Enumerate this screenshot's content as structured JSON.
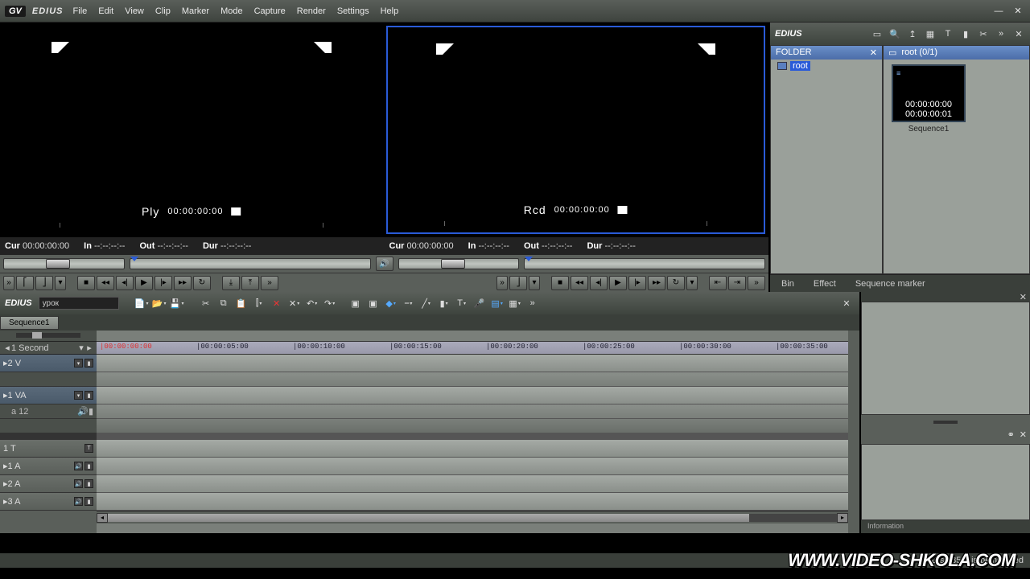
{
  "app": {
    "logo": "GV",
    "title": "EDIUS"
  },
  "menu": [
    "File",
    "Edit",
    "View",
    "Clip",
    "Marker",
    "Mode",
    "Capture",
    "Render",
    "Settings",
    "Help"
  ],
  "monitor_source": {
    "label": "Ply",
    "tc": "00:00:00:00",
    "cur": "00:00:00:00",
    "in": "--:--:--:--",
    "out": "--:--:--:--",
    "dur": "--:--:--:--",
    "cur_lbl": "Cur",
    "in_lbl": "In",
    "out_lbl": "Out",
    "dur_lbl": "Dur"
  },
  "monitor_record": {
    "label": "Rcd",
    "tc": "00:00:00:00",
    "cur": "00:00:00:00",
    "in": "--:--:--:--",
    "out": "--:--:--:--",
    "dur": "--:--:--:--",
    "cur_lbl": "Cur",
    "in_lbl": "In",
    "out_lbl": "Out",
    "dur_lbl": "Dur"
  },
  "bin": {
    "title": "EDIUS",
    "folder_header": "FOLDER",
    "root_folder": "root",
    "clip_header": "root (0/1)",
    "clip": {
      "tc1": "00:00:00:00",
      "tc2": "00:00:00:01",
      "name": "Sequence1"
    },
    "tabs": {
      "bin": "Bin",
      "effect": "Effect",
      "marker": "Sequence marker"
    }
  },
  "timeline": {
    "title": "EDIUS",
    "project": "урок",
    "seq_tab": "Sequence1",
    "scale": "1 Second",
    "ruler": [
      {
        "tc": "00:00:00:00",
        "pos": 0,
        "red": true
      },
      {
        "tc": "00:00:05:00",
        "pos": 120
      },
      {
        "tc": "00:00:10:00",
        "pos": 240
      },
      {
        "tc": "00:00:15:00",
        "pos": 360
      },
      {
        "tc": "00:00:20:00",
        "pos": 480
      },
      {
        "tc": "00:00:25:00",
        "pos": 600
      },
      {
        "tc": "00:00:30:00",
        "pos": 720
      },
      {
        "tc": "00:00:35:00",
        "pos": 840
      }
    ],
    "tracks": {
      "v2": "2 V",
      "va1": "1 VA",
      "va1_sub": "a 12",
      "t1": "1 T",
      "a1": "1 A",
      "a2": "2 A",
      "a3": "3 A"
    }
  },
  "info_tab": "Information",
  "status": {
    "disk": "Disk:85% is being used"
  },
  "watermark": "WWW.VIDEO-SHKOLA.COM"
}
